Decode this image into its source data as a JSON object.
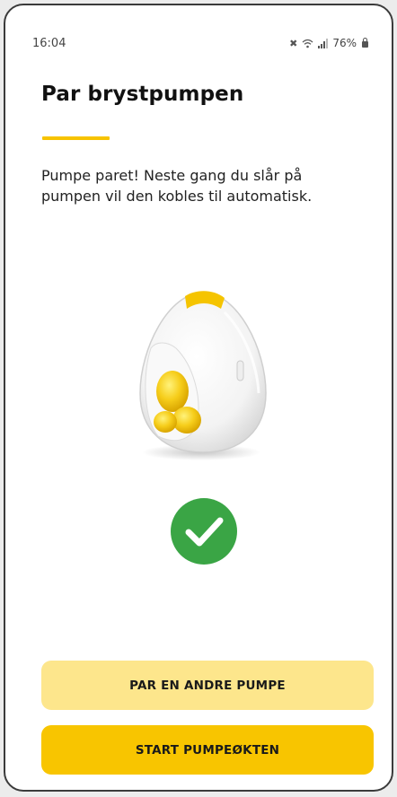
{
  "status_bar": {
    "time": "16:04",
    "battery": "76%",
    "icons": [
      "mute-icon",
      "wifi-icon",
      "signal-icon",
      "battery-icon"
    ]
  },
  "header": {
    "title": "Par brystpumpen"
  },
  "main": {
    "description": "Pumpe paret! Neste gang du slår på pumpen vil den kobles til automatisk.",
    "product_image": "wearable-breast-pump",
    "success_icon": "check-circle-icon"
  },
  "actions": {
    "pair_another_label": "PAR EN ANDRE PUMPE",
    "start_session_label": "START PUMPEØKTEN"
  },
  "colors": {
    "accent": "#f7c300",
    "primary_button": "#f8c500",
    "secondary_button": "#fde68c",
    "success": "#3aa545"
  }
}
